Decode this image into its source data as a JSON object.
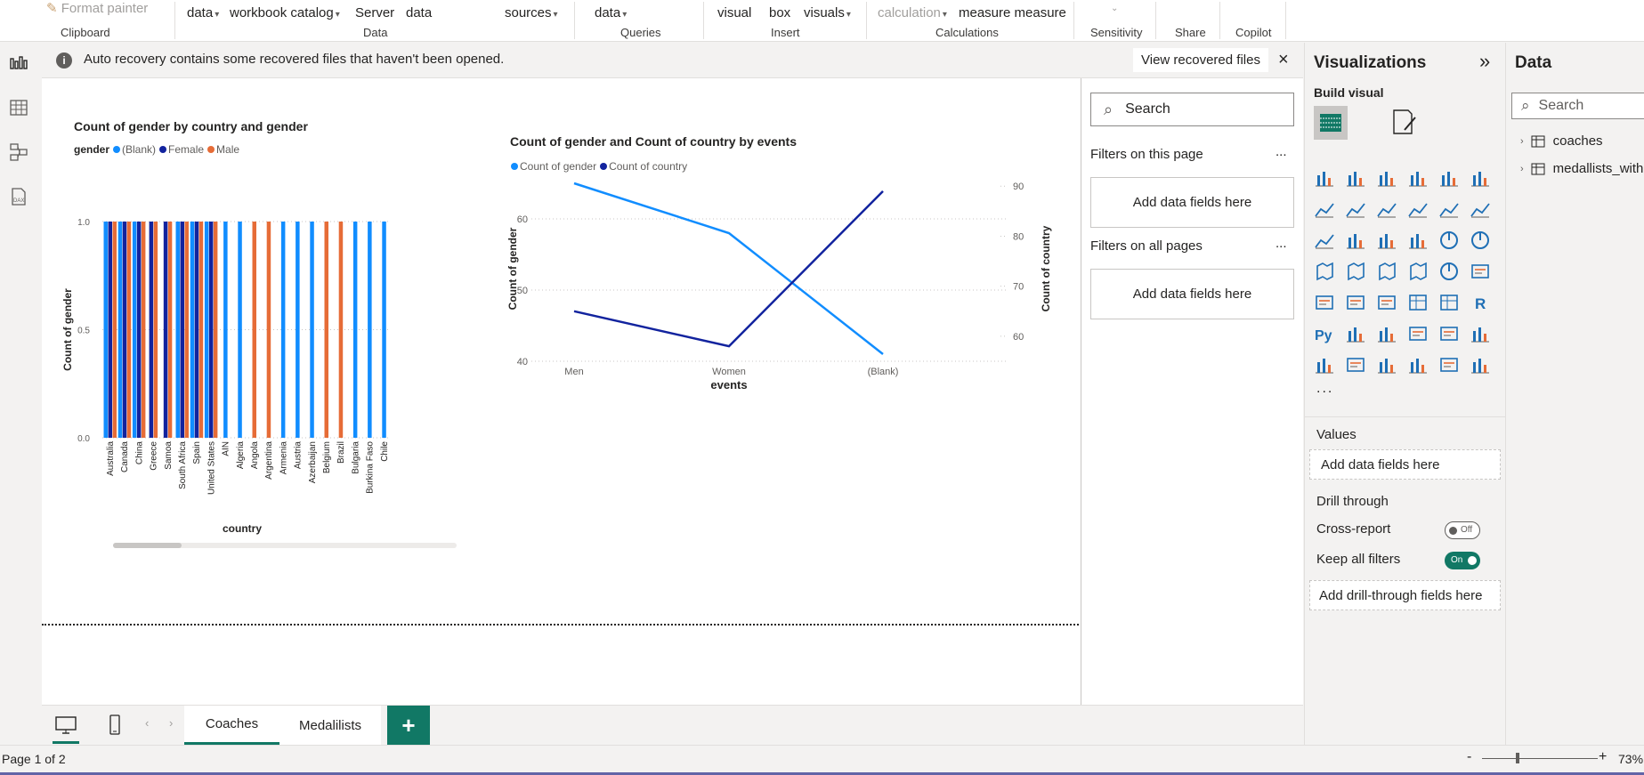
{
  "ribbon": {
    "items": [
      {
        "label": "Format painter",
        "dim": true
      },
      {
        "label": "data",
        "caret": true
      },
      {
        "label": "workbook catalog",
        "caret": true
      },
      {
        "label": "Server"
      },
      {
        "label": "data"
      },
      {
        "label": "sources",
        "caret": true
      },
      {
        "label": "data",
        "caret": true
      },
      {
        "label": "visual"
      },
      {
        "label": "box"
      },
      {
        "label": "visuals",
        "caret": true
      },
      {
        "label": "calculation",
        "caret": true,
        "dim": true
      },
      {
        "label": "measure measure"
      }
    ],
    "groups": [
      "Clipboard",
      "Data",
      "Queries",
      "Insert",
      "Calculations",
      "Sensitivity",
      "Share",
      "Copilot"
    ]
  },
  "notice": {
    "text": "Auto recovery contains some recovered files that haven't been opened.",
    "button": "View recovered files"
  },
  "chart1": {
    "title": "Count of gender by country and gender",
    "legend_title": "gender",
    "xlabel": "country",
    "ylabel": "Count of gender"
  },
  "chart2": {
    "title": "Count of gender and Count of country by events",
    "xlabel": "events",
    "ylabel_left": "Count of gender",
    "ylabel_right": "Count of country"
  },
  "chart_data": [
    {
      "type": "bar",
      "title": "Count of gender by country and gender",
      "xlabel": "country",
      "ylabel": "Count of gender",
      "ylim": [
        0,
        1.0
      ],
      "yticks": [
        "0.0",
        "0.5",
        "1.0"
      ],
      "legend": "top-left",
      "categories": [
        "Australia",
        "Canada",
        "China",
        "Greece",
        "Samoa",
        "South Africa",
        "Spain",
        "United States",
        "AIN",
        "Algeria",
        "Angola",
        "Argentina",
        "Armenia",
        "Austria",
        "Azerbaijan",
        "Belgium",
        "Brazil",
        "Bulgaria",
        "Burkina Faso",
        "Chile"
      ],
      "series": [
        {
          "name": "(Blank)",
          "color": "#118dff",
          "values": [
            1,
            1,
            1,
            0,
            0,
            1,
            1,
            1,
            1,
            1,
            0,
            0,
            1,
            1,
            1,
            0,
            0,
            1,
            1,
            1
          ]
        },
        {
          "name": "Female",
          "color": "#12239e",
          "values": [
            1,
            1,
            1,
            1,
            1,
            1,
            1,
            1,
            0,
            0,
            0,
            0,
            0,
            0,
            0,
            0,
            0,
            0,
            0,
            0
          ]
        },
        {
          "name": "Male",
          "color": "#e66c37",
          "values": [
            1,
            1,
            1,
            1,
            1,
            1,
            1,
            1,
            0,
            0,
            1,
            1,
            0,
            0,
            0,
            1,
            1,
            0,
            0,
            0
          ]
        }
      ]
    },
    {
      "type": "line",
      "title": "Count of gender and Count of country by events",
      "xlabel": "events",
      "categories": [
        "Men",
        "Women",
        "(Blank)"
      ],
      "y_left": {
        "label": "Count of gender",
        "ticks": [
          40,
          50,
          60
        ],
        "range": [
          40,
          66
        ]
      },
      "y_right": {
        "label": "Count of country",
        "ticks": [
          60,
          70,
          80,
          90
        ],
        "range": [
          55,
          92
        ]
      },
      "legend": "top-left",
      "series": [
        {
          "name": "Count of gender",
          "color": "#118dff",
          "axis": "left",
          "values": [
            65,
            58,
            41
          ]
        },
        {
          "name": "Count of country",
          "color": "#12239e",
          "axis": "right",
          "values": [
            65,
            58,
            89
          ]
        }
      ]
    }
  ],
  "filters": {
    "search_placeholder": "Search",
    "this_page": "Filters on this page",
    "all_pages": "Filters on all pages",
    "add_fields": "Add data fields here",
    "more": "..."
  },
  "viz": {
    "title": "Visualizations",
    "build": "Build visual",
    "values": "Values",
    "values_well": "Add data fields here",
    "drill": "Drill through",
    "cross_report": "Cross-report",
    "cross_state": "Off",
    "keep_filters": "Keep all filters",
    "keep_state": "On",
    "drill_well": "Add drill-through fields here",
    "more": "..."
  },
  "data_pane": {
    "title": "Data",
    "search_placeholder": "Search",
    "tables": [
      "coaches",
      "medallists_with"
    ]
  },
  "tabs": [
    "Coaches",
    "Medalilists"
  ],
  "status": {
    "page": "Page 1 of 2",
    "zoom": "73%"
  },
  "colors": {
    "accent": "#117865",
    "blue": "#118dff",
    "navy": "#12239e",
    "orange": "#e66c37"
  }
}
